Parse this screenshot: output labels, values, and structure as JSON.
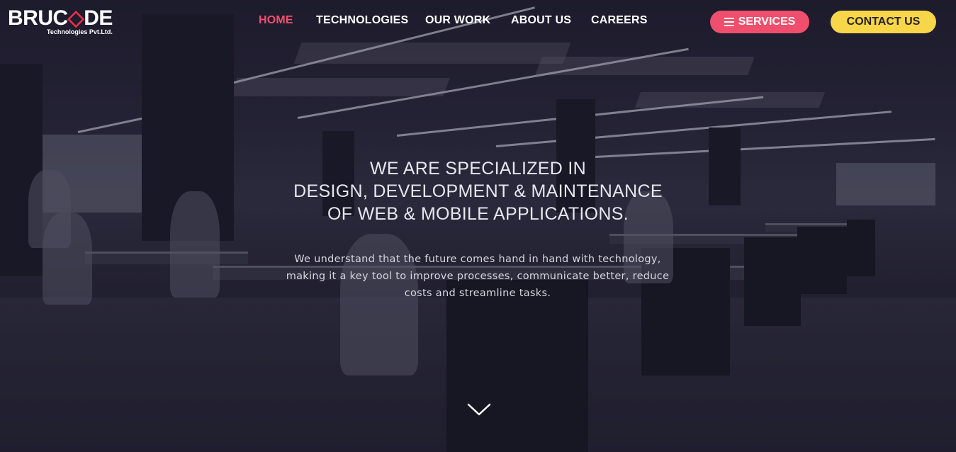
{
  "logo": {
    "name_part1": "BRUC",
    "name_mark": "◇",
    "name_part2": "DE",
    "tagline": "Technologies Pvt.Ltd."
  },
  "nav": {
    "items": [
      {
        "label": "HOME",
        "active": true
      },
      {
        "label": "TECHNOLOGIES",
        "active": false
      },
      {
        "label": "OUR WORK",
        "active": false
      },
      {
        "label": "ABOUT US",
        "active": false
      },
      {
        "label": "CAREERS",
        "active": false
      }
    ],
    "services_label": "SERVICES",
    "contact_label": "CONTACT US"
  },
  "hero": {
    "headline_lines": [
      "WE ARE SPECIALIZED IN",
      "DESIGN, DEVELOPMENT & MAINTENANCE",
      "OF WEB & MOBILE APPLICATIONS."
    ],
    "subtext_lines": [
      "We understand that the future comes hand in hand with technology,",
      "making it a key tool to improve processes, communicate better, reduce",
      "costs and streamline tasks."
    ]
  },
  "icons": {
    "menu": "hamburger-icon",
    "scroll": "chevron-down-icon"
  },
  "colors": {
    "accent_pink": "#ef4f6c",
    "accent_yellow": "#f8d64a",
    "active_nav": "#f0506e",
    "text_white": "#ffffff"
  }
}
